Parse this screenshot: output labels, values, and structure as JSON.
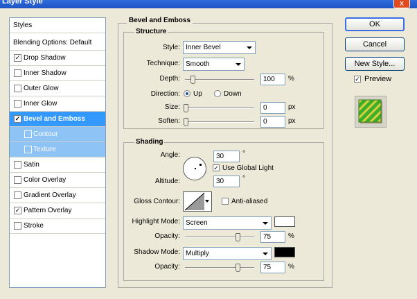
{
  "window": {
    "title": "Layer Style",
    "close_glyph": "x"
  },
  "left_panel": {
    "header": "Styles",
    "blending": "Blending Options: Default",
    "items": [
      {
        "label": "Drop Shadow",
        "checked": true
      },
      {
        "label": "Inner Shadow",
        "checked": false
      },
      {
        "label": "Outer Glow",
        "checked": false
      },
      {
        "label": "Inner Glow",
        "checked": false
      },
      {
        "label": "Bevel and Emboss",
        "checked": true
      },
      {
        "label": "Contour",
        "checked": false
      },
      {
        "label": "Texture",
        "checked": false
      },
      {
        "label": "Satin",
        "checked": false
      },
      {
        "label": "Color Overlay",
        "checked": false
      },
      {
        "label": "Gradient Overlay",
        "checked": false
      },
      {
        "label": "Pattern Overlay",
        "checked": true
      },
      {
        "label": "Stroke",
        "checked": false
      }
    ]
  },
  "bevel": {
    "title": "Bevel and Emboss",
    "structure": {
      "title": "Structure",
      "style_label": "Style:",
      "style_value": "Inner Bevel",
      "technique_label": "Technique:",
      "technique_value": "Smooth",
      "depth_label": "Depth:",
      "depth_value": "100",
      "depth_unit": "%",
      "direction_label": "Direction:",
      "up_label": "Up",
      "down_label": "Down",
      "size_label": "Size:",
      "size_value": "0",
      "size_unit": "px",
      "soften_label": "Soften:",
      "soften_value": "0",
      "soften_unit": "px"
    },
    "shading": {
      "title": "Shading",
      "angle_label": "Angle:",
      "angle_value": "30",
      "angle_unit": "°",
      "global_light_label": "Use Global Light",
      "altitude_label": "Altitude:",
      "altitude_value": "30",
      "altitude_unit": "°",
      "gloss_label": "Gloss Contour:",
      "anti_aliased_label": "Anti-aliased",
      "highlight_mode_label": "Highlight Mode:",
      "highlight_mode_value": "Screen",
      "highlight_opacity_label": "Opacity:",
      "highlight_opacity_value": "75",
      "highlight_opacity_unit": "%",
      "shadow_mode_label": "Shadow Mode:",
      "shadow_mode_value": "Multiply",
      "shadow_opacity_label": "Opacity:",
      "shadow_opacity_value": "75",
      "shadow_opacity_unit": "%",
      "highlight_color": "#ffffff",
      "shadow_color": "#000000"
    }
  },
  "buttons": {
    "ok": "OK",
    "cancel": "Cancel",
    "new_style": "New Style...",
    "preview": "Preview"
  },
  "colors": {
    "selection": "#3399ff",
    "sub_selection": "#8ec3f5",
    "title_bar": "#2f6bdc"
  }
}
